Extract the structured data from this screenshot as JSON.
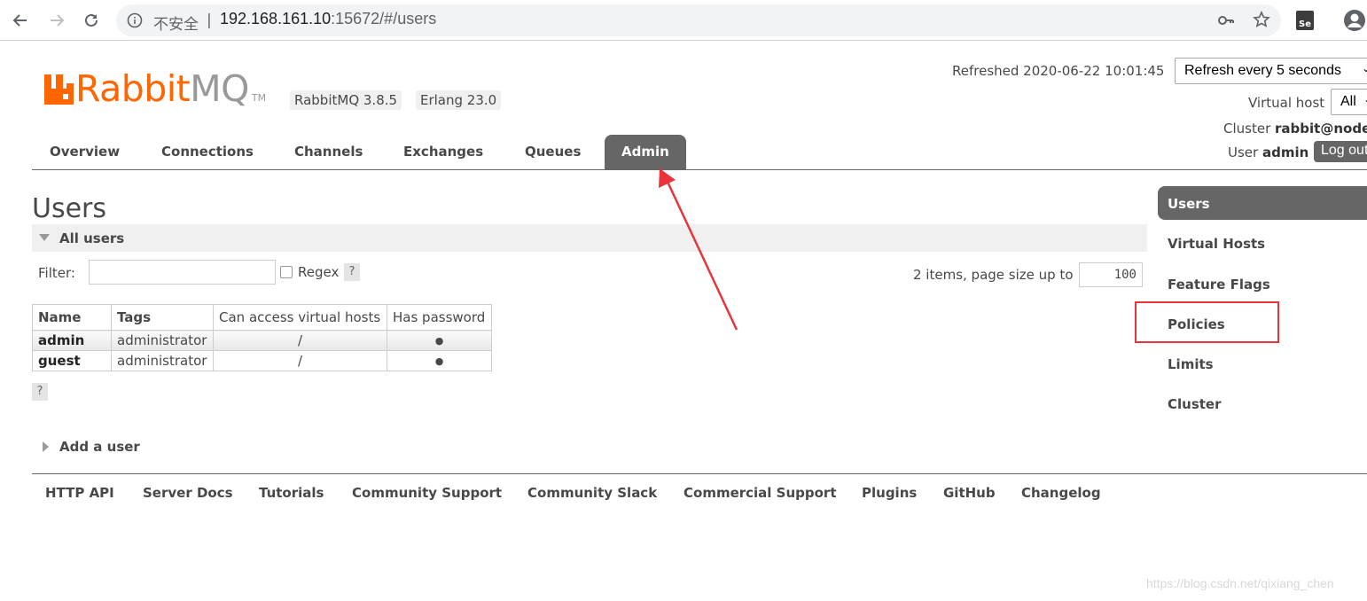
{
  "browser": {
    "insecure_label": "不安全",
    "url_host": "192.168.161.10",
    "url_rest": ":15672/#/users",
    "extension_label": "Se"
  },
  "header": {
    "logo_rabbit": "Rabbit",
    "logo_mq": "MQ",
    "logo_tm": "TM",
    "rabbitmq_version": "RabbitMQ 3.8.5",
    "erlang_version": "Erlang 23.0",
    "refreshed": "Refreshed 2020-06-22 10:01:45",
    "refresh_option": "Refresh every 5 seconds",
    "vhost_label": "Virtual host",
    "vhost_option": "All",
    "cluster_label": "Cluster",
    "cluster_value": "rabbit@node",
    "user_label": "User",
    "user_value": "admin",
    "logout_label": "Log out"
  },
  "tabs": [
    {
      "label": "Overview"
    },
    {
      "label": "Connections"
    },
    {
      "label": "Channels"
    },
    {
      "label": "Exchanges"
    },
    {
      "label": "Queues"
    },
    {
      "label": "Admin"
    }
  ],
  "subnav": [
    {
      "label": "Users"
    },
    {
      "label": "Virtual Hosts"
    },
    {
      "label": "Feature Flags"
    },
    {
      "label": "Policies"
    },
    {
      "label": "Limits"
    },
    {
      "label": "Cluster"
    }
  ],
  "main": {
    "title": "Users",
    "section_label": "All users",
    "filter_label": "Filter:",
    "filter_value": "",
    "regex_label": "Regex",
    "help": "?",
    "items_label": "2 items, page size up to",
    "page_size": "100",
    "add_user_label": "Add a user"
  },
  "table": {
    "headers": [
      "Name",
      "Tags",
      "Can access virtual hosts",
      "Has password"
    ],
    "rows": [
      {
        "name": "admin",
        "tags": "administrator",
        "vhosts": "/",
        "password": "●"
      },
      {
        "name": "guest",
        "tags": "administrator",
        "vhosts": "/",
        "password": "●"
      }
    ]
  },
  "footer": [
    {
      "label": "HTTP API"
    },
    {
      "label": "Server Docs"
    },
    {
      "label": "Tutorials"
    },
    {
      "label": "Community Support"
    },
    {
      "label": "Community Slack"
    },
    {
      "label": "Commercial Support"
    },
    {
      "label": "Plugins"
    },
    {
      "label": "GitHub"
    },
    {
      "label": "Changelog"
    }
  ],
  "watermark": "https://blog.csdn.net/qixiang_chen",
  "colors": {
    "brand_orange": "#ff6600",
    "tab_active": "#666666",
    "annotation_red": "#e8343a"
  }
}
